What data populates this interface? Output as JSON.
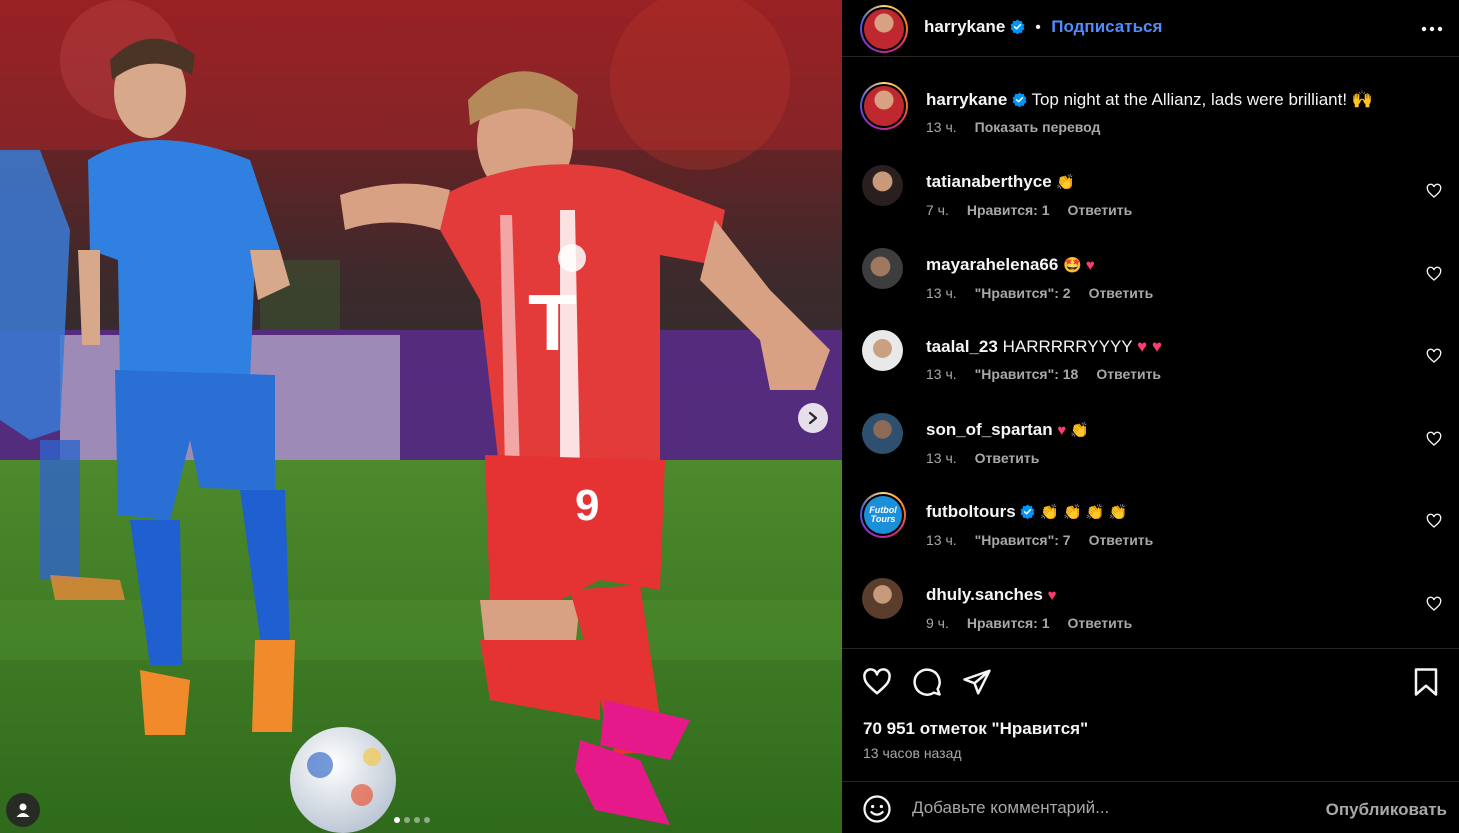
{
  "post": {
    "author": "harrykane",
    "follow_label": "Подписаться",
    "caption_text": "Top night at the Allianz, lads were brilliant! 🙌",
    "caption_time": "13 ч.",
    "translate_label": "Показать перевод"
  },
  "carousel": {
    "total": 4,
    "current": 1
  },
  "comments": [
    {
      "user": "tatianaberthyce",
      "text": "👏",
      "time": "7 ч.",
      "likes": "Нравится: 1",
      "reply": "Ответить"
    },
    {
      "user": "mayarahelena66",
      "text": "🤩 💗",
      "time": "13 ч.",
      "likes": "\"Нравится\": 2",
      "reply": "Ответить"
    },
    {
      "user": "taalal_23",
      "text": "HARRRRRYYYY 💗 💗",
      "time": "13 ч.",
      "likes": "\"Нравится\": 18",
      "reply": "Ответить"
    },
    {
      "user": "son_of_spartan",
      "text": "💗 👏",
      "time": "13 ч.",
      "likes": "",
      "reply": "Ответить"
    },
    {
      "user": "futboltours",
      "text": "👏 👏 👏 👏",
      "time": "13 ч.",
      "likes": "\"Нравится\": 7",
      "reply": "Ответить",
      "verified": true,
      "avatar_text": "Futbol Tours"
    },
    {
      "user": "dhuly.sanches",
      "text": "💗",
      "time": "9 ч.",
      "likes": "Нравится: 1",
      "reply": "Ответить"
    }
  ],
  "stats": {
    "likes_label": "70 951 отметок \"Нравится\"",
    "time_ago": "13 часов назад"
  },
  "add_comment": {
    "placeholder": "Добавьте комментарий...",
    "post_label": "Опубликовать"
  },
  "colors": {
    "accent": "#4f8cff",
    "verified": "#0095f6",
    "heart_pink": "#ff3b6f"
  }
}
